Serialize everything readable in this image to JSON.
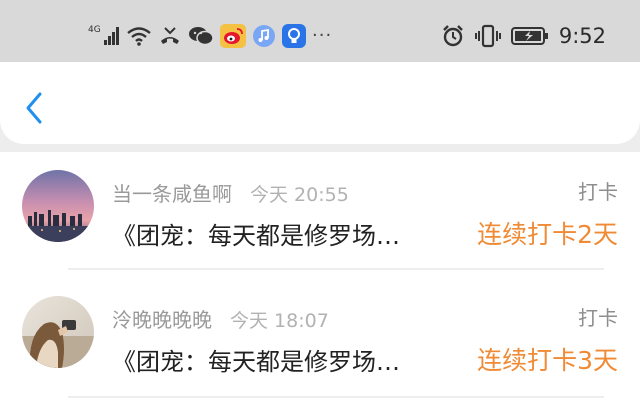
{
  "status_bar": {
    "network_label": "4G",
    "time": "9:52",
    "more_label": "···",
    "icons": [
      "signal-4g-icon",
      "wifi-icon",
      "missed-call-icon",
      "wechat-icon",
      "weibo-icon",
      "music-icon",
      "bulb-app-icon",
      "alarm-icon",
      "vibrate-icon",
      "battery-icon"
    ]
  },
  "header": {
    "back_icon": "chevron-left-icon",
    "accent_color": "#1f8ff0"
  },
  "entries": [
    {
      "name": "当一条咸鱼啊",
      "time": "今天 20:55",
      "title": "《团宠：每天都是修罗场…",
      "tag": "打卡",
      "streak": "连续打卡2天"
    },
    {
      "name": "泠晚晚晚晚",
      "time": "今天 18:07",
      "title": "《团宠：每天都是修罗场…",
      "tag": "打卡",
      "streak": "连续打卡3天"
    }
  ],
  "colors": {
    "streak": "#f08a34",
    "status_bar_bg": "#d9d9d9",
    "page_bg": "#ededed"
  }
}
